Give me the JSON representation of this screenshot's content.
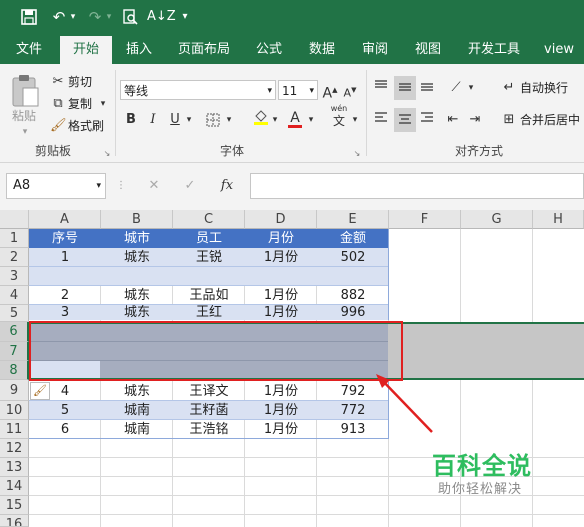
{
  "quick_access": {
    "save_icon": "save-icon",
    "undo_icon": "undo-icon",
    "redo_icon": "redo-icon",
    "print_preview_icon": "print-preview-icon",
    "sort_icon": "sort-icon",
    "customize_icon": "customize-icon"
  },
  "tabs": [
    "文件",
    "开始",
    "插入",
    "页面布局",
    "公式",
    "数据",
    "审阅",
    "视图",
    "开发工具",
    "view"
  ],
  "active_tab": "开始",
  "clipboard": {
    "paste": "粘贴",
    "cut": "剪切",
    "copy": "复制",
    "format_painter": "格式刷",
    "group_label": "剪贴板"
  },
  "font": {
    "name": "等线",
    "size": "11",
    "grow": "A",
    "shrink": "A",
    "bold": "B",
    "italic": "I",
    "underline": "U",
    "font_color_letter": "A",
    "phonetic": "wén",
    "phonetic_char": "文",
    "group_label": "字体"
  },
  "alignment": {
    "wrap_text": "自动换行",
    "merge_center": "合并后居中",
    "group_label": "对齐方式"
  },
  "formula_bar": {
    "name_box": "A8",
    "fx": "fx",
    "cancel": "✕",
    "enter": "✓",
    "formula": ""
  },
  "columns": [
    "A",
    "B",
    "C",
    "D",
    "E",
    "F",
    "G",
    "H"
  ],
  "rows": [
    "1",
    "2",
    "3",
    "4",
    "5",
    "6",
    "7",
    "8",
    "9",
    "10",
    "11",
    "12",
    "13",
    "14",
    "15",
    "16"
  ],
  "table": {
    "headers": [
      "序号",
      "城市",
      "员工",
      "月份",
      "金额"
    ],
    "rows": [
      {
        "row": "2",
        "cells": [
          "1",
          "城东",
          "王锐",
          "1月份",
          "502"
        ]
      },
      {
        "row": "3",
        "cells": [
          "",
          "",
          "",
          "",
          ""
        ]
      },
      {
        "row": "4",
        "cells": [
          "2",
          "城东",
          "王品如",
          "1月份",
          "882"
        ]
      },
      {
        "row": "5",
        "cells": [
          "3",
          "城东",
          "王红",
          "1月份",
          "996"
        ]
      },
      {
        "row": "9",
        "cells": [
          "4",
          "城东",
          "王译文",
          "1月份",
          "792"
        ]
      },
      {
        "row": "10",
        "cells": [
          "5",
          "城南",
          "王籽菡",
          "1月份",
          "772"
        ]
      },
      {
        "row": "11",
        "cells": [
          "6",
          "城南",
          "王浩铭",
          "1月份",
          "913"
        ]
      }
    ]
  },
  "colors": {
    "excel_green": "#217346",
    "header_blue": "#4472c4",
    "band_blue": "#d9e1f2",
    "selection_gray": "#c6c6c6",
    "highlight_red": "#e02020"
  },
  "watermark": {
    "title": "百科全说",
    "subtitle": "助你轻松解决"
  }
}
